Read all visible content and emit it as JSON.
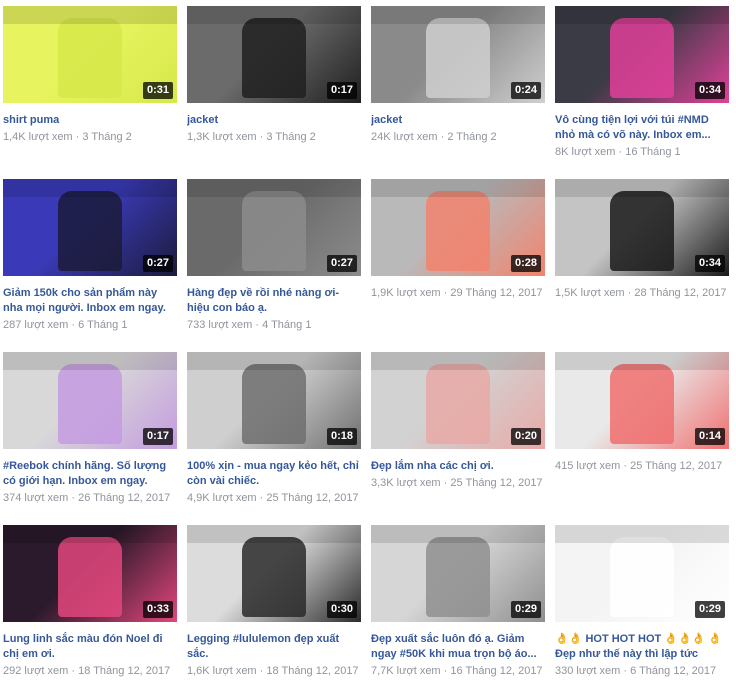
{
  "videos": [
    {
      "title": "shirt puma",
      "views": "1,4K lượt xem",
      "date": "3 Tháng 2",
      "duration": "0:31",
      "bg": "#e7f45f",
      "accent": "#d6e84a"
    },
    {
      "title": "jacket",
      "views": "1,3K lượt xem",
      "date": "3 Tháng 2",
      "duration": "0:17",
      "bg": "#6b6b6b",
      "accent": "#202020"
    },
    {
      "title": "jacket",
      "views": "24K lượt xem",
      "date": "2 Tháng 2",
      "duration": "0:24",
      "bg": "#8a8a8a",
      "accent": "#cfcfcf"
    },
    {
      "title": "Vô cùng tiện lợi với túi #NMD nhỏ mà có võ này. Inbox em...",
      "views": "8K lượt xem",
      "date": "16 Tháng 1",
      "duration": "0:34",
      "bg": "#3b3b45",
      "accent": "#e2409a"
    },
    {
      "title": "Giảm 150k cho sản phẩm này nha mọi người. Inbox em ngay.",
      "views": "287 lượt xem",
      "date": "6 Tháng 1",
      "duration": "0:27",
      "bg": "#3a3ab8",
      "accent": "#1b1b3a"
    },
    {
      "title": "Hàng đẹp về rồi nhé nàng ơi- hiệu con báo ạ.",
      "views": "733 lượt xem",
      "date": "4 Tháng 1",
      "duration": "0:27",
      "bg": "#6a6a6a",
      "accent": "#8c8c8c"
    },
    {
      "title": "",
      "views": "1,9K lượt xem",
      "date": "29 Tháng 12, 2017",
      "duration": "0:28",
      "bg": "#b9b9b9",
      "accent": "#f2836d"
    },
    {
      "title": "",
      "views": "1,5K lượt xem",
      "date": "28 Tháng 12, 2017",
      "duration": "0:34",
      "bg": "#c4c4c4",
      "accent": "#1a1a1a"
    },
    {
      "title": "#Reebok chính hãng. Số lượng có giới hạn. Inbox em ngay.",
      "views": "374 lượt xem",
      "date": "26 Tháng 12, 2017",
      "duration": "0:17",
      "bg": "#d8d8d8",
      "accent": "#c49be0"
    },
    {
      "title": "100% xịn - mua ngay kẻo hết, chỉ còn vài chiếc.",
      "views": "4,9K lượt xem",
      "date": "25 Tháng 12, 2017",
      "duration": "0:18",
      "bg": "#cfcfcf",
      "accent": "#6f6f6f"
    },
    {
      "title": "Đẹp lắm nha các chị ơi.",
      "views": "3,3K lượt xem",
      "date": "25 Tháng 12, 2017",
      "duration": "0:20",
      "bg": "#d2d2d2",
      "accent": "#e8a9a6"
    },
    {
      "title": "",
      "views": "415 lượt xem",
      "date": "25 Tháng 12, 2017",
      "duration": "0:14",
      "bg": "#e9e9e9",
      "accent": "#f06f6f"
    },
    {
      "title": "Lung linh sắc màu đón Noel đi chị em ơi.",
      "views": "292 lượt xem",
      "date": "18 Tháng 12, 2017",
      "duration": "0:33",
      "bg": "#2b1a2b",
      "accent": "#e3467c"
    },
    {
      "title": "Legging #lululemon đẹp xuất sắc.",
      "views": "1,6K lượt xem",
      "date": "18 Tháng 12, 2017",
      "duration": "0:30",
      "bg": "#dcdcdc",
      "accent": "#2a2a2a"
    },
    {
      "title": "Đẹp xuất sắc luôn đó ạ. Giảm ngay #50K khi mua trọn bộ áo...",
      "views": "7,7K lượt xem",
      "date": "16 Tháng 12, 2017",
      "duration": "0:29",
      "bg": "#d6d6d6",
      "accent": "#8f8f8f"
    },
    {
      "title": "👌👌 HOT HOT HOT 👌👌👌 👌 Đẹp như thế này thì lập tức phải...",
      "views": "330 lượt xem",
      "date": "6 Tháng 12, 2017",
      "duration": "0:29",
      "bg": "#f4f4f4",
      "accent": "#ffffff"
    }
  ]
}
